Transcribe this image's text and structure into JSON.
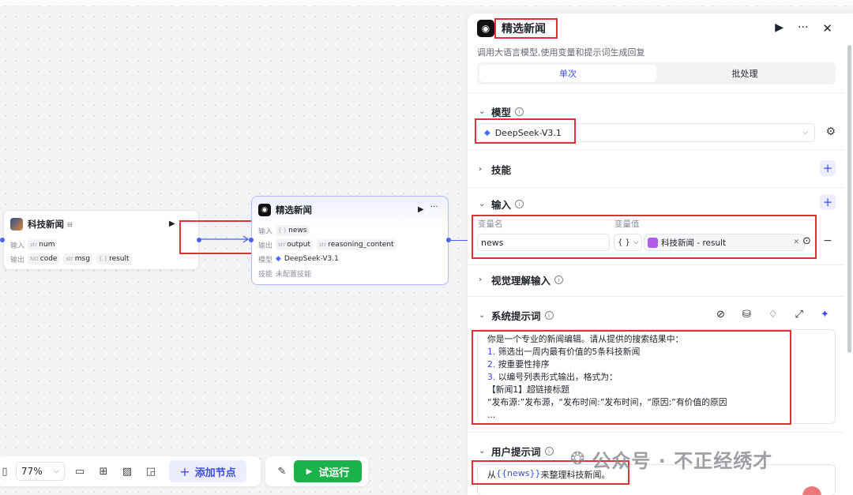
{
  "canvas": {
    "node1": {
      "title": "科技新闻",
      "input_label": "输入",
      "output_label": "输出",
      "inputs": [
        {
          "type": "str",
          "name": "num"
        }
      ],
      "outputs": [
        {
          "type": "NO",
          "name": "code"
        },
        {
          "type": "str",
          "name": "msg"
        },
        {
          "type": "{ }",
          "name": "result"
        }
      ]
    },
    "node2": {
      "title": "精选新闻",
      "input_label": "输入",
      "output_label": "输出",
      "model_label": "模型",
      "skills_label": "技能",
      "inputs": [
        {
          "type": "{ }",
          "name": "news"
        }
      ],
      "outputs": [
        {
          "type": "str",
          "name": "output"
        },
        {
          "type": "str",
          "name": "reasoning_content"
        }
      ],
      "model": "DeepSeek-V3.1",
      "skills": "未配置技能"
    }
  },
  "toolbar": {
    "zoom": "77%",
    "add_node": "添加节点",
    "run": "试运行"
  },
  "panel": {
    "title": "精选新闻",
    "description": "调用大语言模型,使用变量和提示词生成回复",
    "tabs": [
      "单次",
      "批处理"
    ],
    "model_section": "模型",
    "model_value": "DeepSeek-V3.1",
    "skills_section": "技能",
    "input_section": "输入",
    "var_name_header": "变量名",
    "var_value_header": "变量值",
    "var_name": "news",
    "var_type": "{ }",
    "var_ref": "科技新闻 - result",
    "vision_section": "视觉理解输入",
    "system_prompt_section": "系统提示词",
    "system_prompt_lines": [
      "你是一个专业的新闻编辑。请从提供的搜索结果中：",
      "1. 筛选出一周内最有价值的5条科技新闻",
      "2. 按重要性排序",
      "3. 以编号列表形式输出，格式为：",
      "【新闻1】超链接标题",
      "“发布源:”发布源，“发布时间:”发布时间，“原因:”有价值的原因",
      "..."
    ],
    "user_prompt_section": "用户提示词",
    "user_prompt_prefix": "从",
    "user_prompt_var": "{{news}}",
    "user_prompt_suffix": "来整理科技新闻。"
  },
  "watermark": "公众号 · 不正经绣才",
  "colors": {
    "accent": "#3c4de0",
    "run": "#1cb24a",
    "highlight": "#e0313a"
  }
}
